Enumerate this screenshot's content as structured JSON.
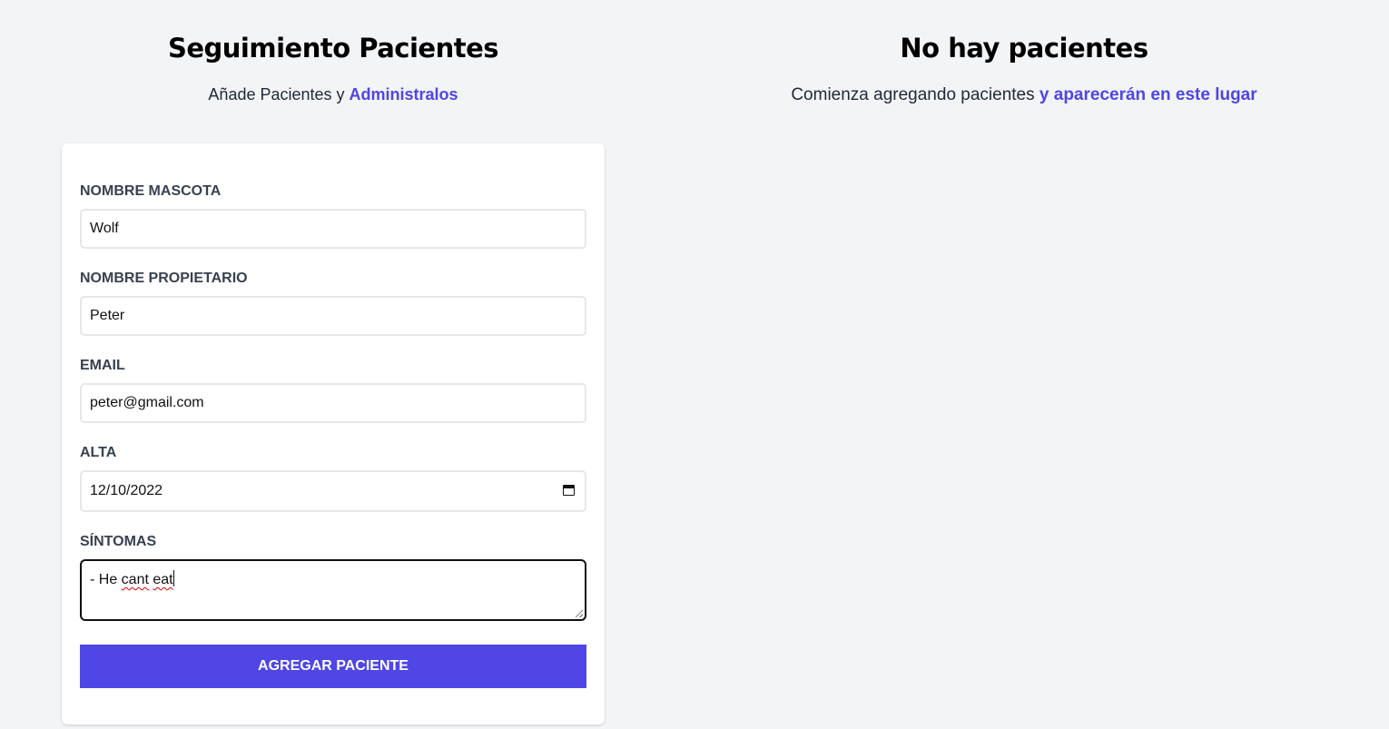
{
  "form_panel": {
    "title": "Seguimiento Pacientes",
    "subtitle_prefix": "Añade Pacientes y ",
    "subtitle_accent": "Administralos",
    "fields": {
      "pet_name": {
        "label": "Nombre Mascota",
        "value": "Wolf"
      },
      "owner_name": {
        "label": "Nombre Propietario",
        "value": "Peter"
      },
      "email": {
        "label": "Email",
        "value": "peter@gmail.com"
      },
      "discharge": {
        "label": "Alta",
        "value": "12/10/2022"
      },
      "symptoms": {
        "label": "Síntomas",
        "value_prefix": "- He ",
        "value_word1": "cant",
        "value_space": " ",
        "value_word2": "eat"
      }
    },
    "submit_label": "Agregar Paciente"
  },
  "list_panel": {
    "title": "No hay pacientes",
    "subtitle_prefix": "Comienza agregando pacientes ",
    "subtitle_accent": "y aparecerán en este lugar"
  },
  "colors": {
    "accent": "#4f46e5",
    "background": "#f3f4f6",
    "card": "#ffffff"
  },
  "icons": [
    "calendar-icon",
    "resize-grip-icon"
  ]
}
